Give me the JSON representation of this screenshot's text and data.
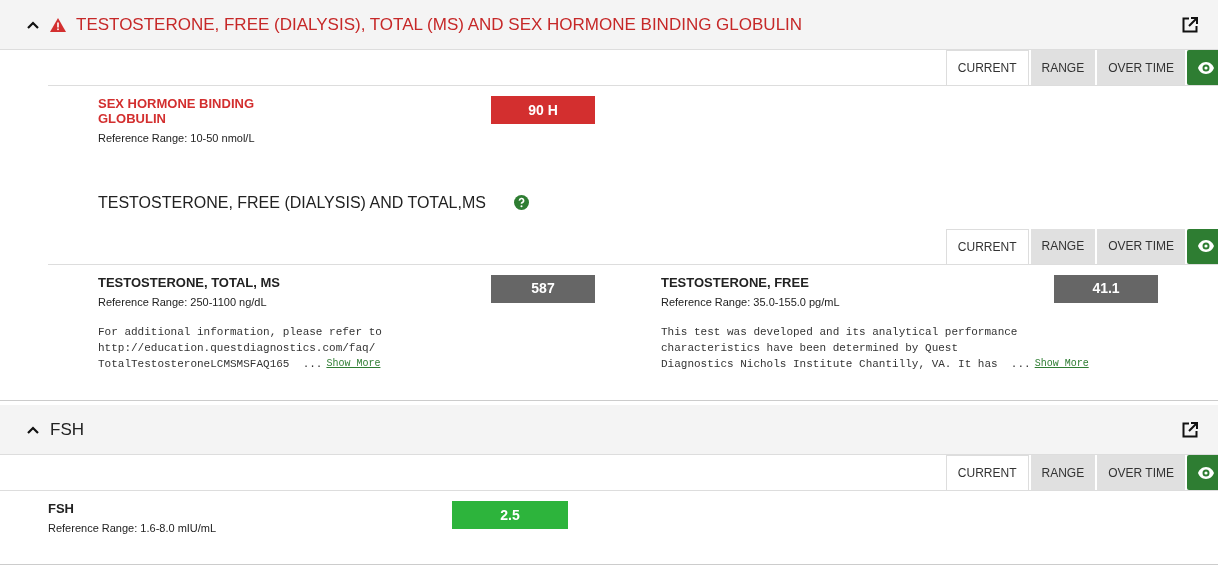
{
  "panels": [
    {
      "title": "TESTOSTERONE, FREE (DIALYSIS), TOTAL (MS) AND SEX HORMONE BINDING GLOBULIN",
      "alert": true,
      "expanded": true,
      "groups": [
        {
          "tabs": [
            {
              "label": "CURRENT",
              "selected": true
            },
            {
              "label": "RANGE",
              "selected": false
            },
            {
              "label": "OVER TIME",
              "selected": false
            }
          ],
          "results": [
            {
              "name": "SEX HORMONE BINDING GLOBULIN",
              "abnormal": true,
              "color": "#d32f2f",
              "value": "90 H",
              "reference": "Reference Range: 10-50 nmol/L"
            }
          ]
        },
        {
          "title": "TESTOSTERONE, FREE (DIALYSIS) AND TOTAL,MS",
          "tabs": [
            {
              "label": "CURRENT",
              "selected": true
            },
            {
              "label": "RANGE",
              "selected": false
            },
            {
              "label": "OVER TIME",
              "selected": false
            }
          ],
          "results": [
            {
              "name": "TESTOSTERONE, TOTAL, MS",
              "abnormal": false,
              "color": "#666666",
              "value": "587",
              "reference": "Reference Range: 250-1100 ng/dL",
              "note_lines": [
                "For additional information, please refer to",
                "http://education.questdiagnostics.com/faq/",
                "TotalTestosteroneLCMSMSFAQ165  ..."
              ],
              "show_more": "Show More"
            },
            {
              "name": "TESTOSTERONE, FREE",
              "abnormal": false,
              "color": "#666666",
              "value": "41.1",
              "reference": "Reference Range: 35.0-155.0 pg/mL",
              "note_lines": [
                "This test was developed and its analytical performance",
                "characteristics have been determined by Quest",
                "Diagnostics Nichols Institute Chantilly, VA. It has  ..."
              ],
              "show_more": "Show More"
            }
          ]
        }
      ]
    },
    {
      "title": "FSH",
      "alert": false,
      "expanded": true,
      "groups": [
        {
          "tabs": [
            {
              "label": "CURRENT",
              "selected": true
            },
            {
              "label": "RANGE",
              "selected": false
            },
            {
              "label": "OVER TIME",
              "selected": false
            }
          ],
          "results": [
            {
              "name": "FSH",
              "abnormal": false,
              "color": "#2db43c",
              "value": "2.5",
              "reference": "Reference Range: 1.6-8.0 mIU/mL"
            }
          ]
        }
      ]
    }
  ]
}
